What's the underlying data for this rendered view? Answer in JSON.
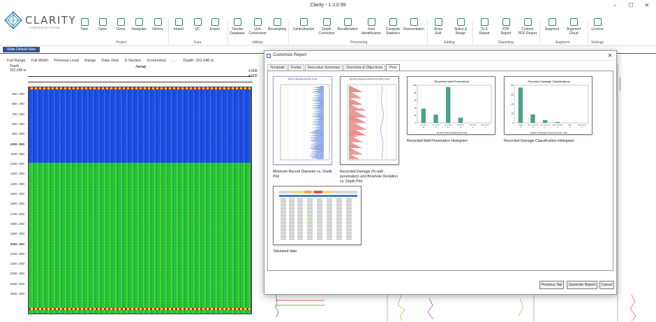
{
  "window": {
    "title": "Clarity - 1.3.0.99",
    "minimize_glyph": "–",
    "maximize_glyph": "☐",
    "close_glyph": "✕"
  },
  "logo": {
    "name": "CLARITY",
    "tagline": "POWERED BY PRISM"
  },
  "ribbon": {
    "buttons": [
      {
        "label": "New",
        "icon": "new-file-icon"
      },
      {
        "label": "Open",
        "icon": "folder-open-icon"
      },
      {
        "label": "Close",
        "icon": "close-file-icon"
      },
      {
        "label": "Navigator",
        "icon": "navigator-icon"
      },
      {
        "label": "History",
        "icon": "history-icon"
      },
      {
        "label": "Import",
        "icon": "import-icon"
      },
      {
        "label": "QC",
        "icon": "qc-icon"
      },
      {
        "label": "Export",
        "icon": "export-icon"
      },
      {
        "label": "Tubular\nDatabase",
        "icon": "database-icon"
      },
      {
        "label": "Unit\nConversion",
        "icon": "unit-conversion-icon"
      },
      {
        "label": "Resampling",
        "icon": "resampling-icon"
      },
      {
        "label": "Centralisation",
        "icon": "centralisation-icon"
      },
      {
        "label": "Depth\nCorrection",
        "icon": "depth-correction-icon"
      },
      {
        "label": "Recalibration",
        "icon": "recalibration-icon"
      },
      {
        "label": "Joint\nIdentification",
        "icon": "joint-identification-icon"
      },
      {
        "label": "Compute\nStatistics",
        "icon": "compute-statistics-icon"
      },
      {
        "label": "Reorientation",
        "icon": "reorientation-icon"
      },
      {
        "label": "Array\nEdit",
        "icon": "array-edit-icon"
      },
      {
        "label": "Splice &\nMerge",
        "icon": "splice-merge-icon"
      },
      {
        "label": "XLS\nReport",
        "icon": "xls-report-icon"
      },
      {
        "label": "PDF\nReport",
        "icon": "pdf-report-icon"
      },
      {
        "label": "Custom\nPDF Report",
        "icon": "custom-pdf-report-icon"
      },
      {
        "label": "Augment",
        "icon": "augment-icon"
      },
      {
        "label": "Augment\nCloud",
        "icon": "augment-cloud-icon"
      },
      {
        "label": "Licence",
        "icon": "licence-icon"
      }
    ],
    "groups": [
      "Project",
      "Data",
      "Utilities",
      "Processing",
      "Editing",
      "Reporting",
      "Augment",
      "Settings"
    ]
  },
  "state_tab": "State Default View",
  "toolbar": {
    "items": [
      "Full Range",
      "Full Width",
      "Previous Level",
      "Range",
      "Data View",
      "X-Section",
      "Screenshot",
      "..."
    ],
    "depth_readout": "Depth: 322.048 m"
  },
  "track": {
    "depth_header": "Depth",
    "depth_value": "322.048 m",
    "array_label": "Array",
    "top_value_1": "4.000",
    "top_value_2": "4.000",
    "depth_ticks": [
      "500 .000",
      "600 .000",
      "700 .000",
      "800 .000",
      "900 .000",
      "1000 .000",
      "1100 .000",
      "1200 .000",
      "1300 .000",
      "1400 .000",
      "1500 .000",
      "1600 .000",
      "1700 .000",
      "1800 .000",
      "1900 .000",
      "2000 .000",
      "2100 .000",
      "2200 .000",
      "2300 .000",
      "2400 .000",
      "2500 .000"
    ]
  },
  "dialog": {
    "title": "Customize Report",
    "tabs": [
      "Template",
      "Footer",
      "Executive Summary",
      "Overview & Objectives",
      "Plots"
    ],
    "active_tab": "Plots",
    "plots": [
      {
        "caption": "Minimum Record Diameter vs. Depth Plot",
        "thumb_title": "Minimum Recorded Diameter Profile"
      },
      {
        "caption": "Recorded Damage (% wall penetration) and Borehole Deviation vs. Depth Plot",
        "thumb_title": "Recorded Damage and Borehole Deviation Profile"
      },
      {
        "caption": "Recorded Wall Penetration Histogram",
        "thumb_title": "Recorded Wall Penetrations"
      },
      {
        "caption": "Recorded Damage Classification Histogram",
        "thumb_title": "Recorded Damage Classifications"
      },
      {
        "caption": "Tabulated data",
        "thumb_title": ""
      }
    ],
    "buttons": {
      "previous": "Previous Tab",
      "generate": "Generate Report",
      "cancel": "Cancel"
    }
  },
  "chart_data": [
    {
      "type": "bar",
      "title": "Recorded Wall Penetrations",
      "xlabel": "Number of joints analysed (total: 140)",
      "ylabel": "",
      "categories": [
        "0 to 10%",
        "10 to 20%",
        "20 to 40%",
        "40 to 60%",
        "60 to 80%",
        "80 to 100%"
      ],
      "values": [
        38,
        22,
        95,
        14,
        0,
        0
      ],
      "ylim": [
        0,
        100
      ],
      "yticks": [
        0,
        20,
        40,
        60,
        80,
        100
      ],
      "color": "#4e9f8c"
    },
    {
      "type": "bar",
      "title": "Recorded Damage Classifications",
      "xlabel": "Number of Damage Occurrences (total = 107)",
      "ylabel": "",
      "categories": [
        "Pitting",
        "Gen. Corrosion",
        "Line Corrosion",
        "Other Damage",
        "Hole",
        "Perforations"
      ],
      "values": [
        75,
        18,
        6,
        2,
        0,
        0
      ],
      "ylim": [
        0,
        80
      ],
      "yticks": [
        0,
        20,
        40,
        60,
        80
      ],
      "color": "#4e9f8c"
    }
  ]
}
